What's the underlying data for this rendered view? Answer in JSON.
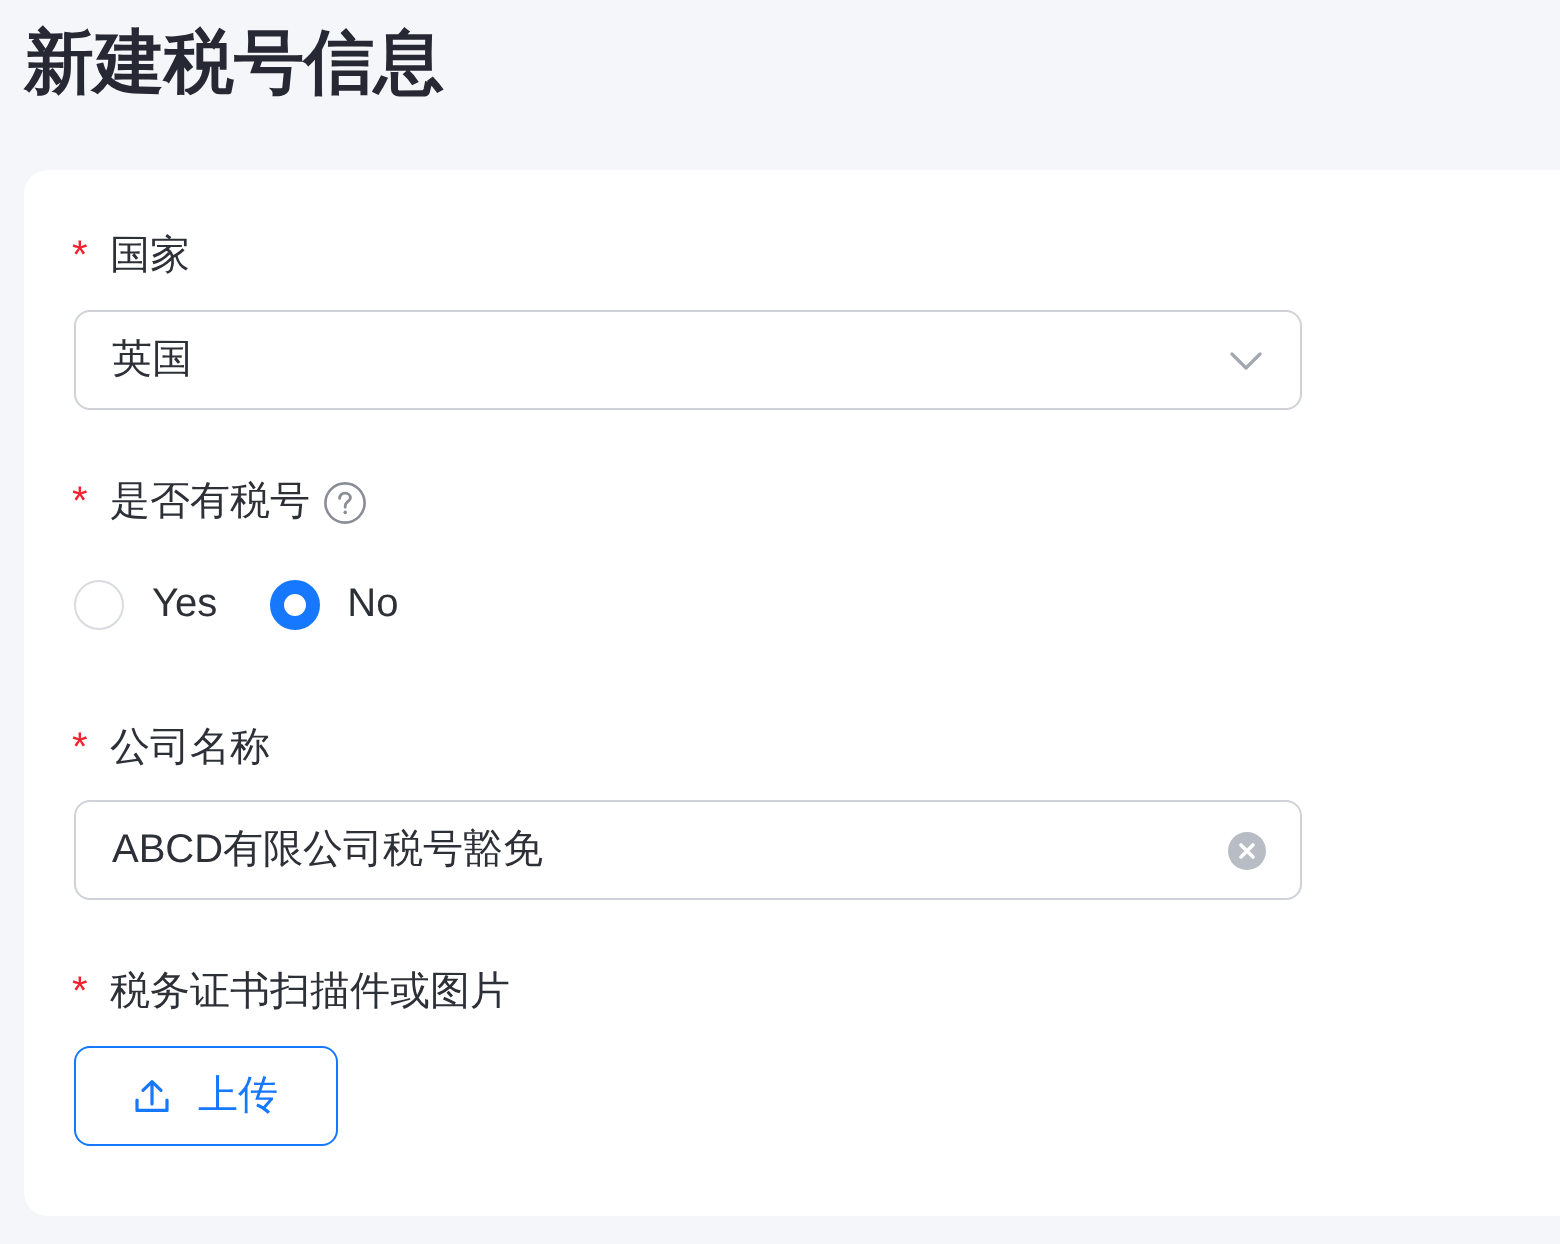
{
  "page": {
    "title": "新建税号信息"
  },
  "form": {
    "fields": [
      {
        "kind": "select",
        "required_mark": "*",
        "label": "国家",
        "value": "英国"
      },
      {
        "kind": "radio",
        "required_mark": "*",
        "label": "是否有税号",
        "help": true,
        "options": [
          {
            "label": "Yes",
            "selected": false
          },
          {
            "label": "No",
            "selected": true
          }
        ]
      },
      {
        "kind": "text",
        "required_mark": "*",
        "label": "公司名称",
        "value": "ABCD有限公司税号豁免",
        "clearable": true
      },
      {
        "kind": "upload",
        "required_mark": "*",
        "label": "税务证书扫描件或图片",
        "button": "上传"
      }
    ]
  }
}
